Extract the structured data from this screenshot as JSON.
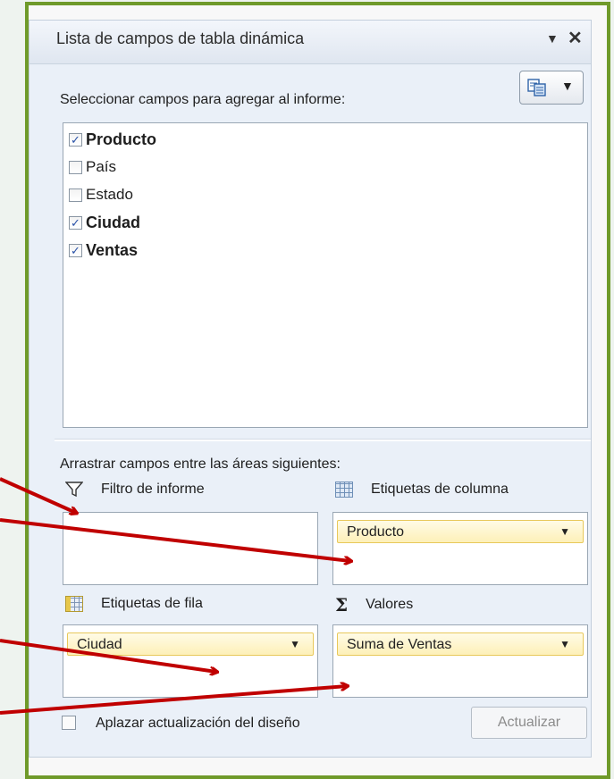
{
  "panel": {
    "title": "Lista de campos de tabla dinámica",
    "title_dropdown_icon": "triangle-down",
    "close_icon": "close-x"
  },
  "view_button": {
    "icon": "field-list-layout-icon"
  },
  "choose_label": "Seleccionar campos para agregar al informe:",
  "fields": [
    {
      "label": "Producto",
      "checked": true
    },
    {
      "label": "País",
      "checked": false
    },
    {
      "label": "Estado",
      "checked": false
    },
    {
      "label": "Ciudad",
      "checked": true
    },
    {
      "label": "Ventas",
      "checked": true
    }
  ],
  "drag_label": "Arrastrar campos entre las áreas siguientes:",
  "areas": {
    "report_filter": {
      "title": "Filtro de informe",
      "icon": "filter-icon",
      "items": []
    },
    "column_labels": {
      "title": "Etiquetas de columna",
      "icon": "column-grid-icon",
      "items": [
        "Producto"
      ]
    },
    "row_labels": {
      "title": "Etiquetas de fila",
      "icon": "row-grid-icon",
      "items": [
        "Ciudad"
      ]
    },
    "values": {
      "title": "Valores",
      "icon": "sigma-icon",
      "symbol": "Σ",
      "items": [
        "Suma de Ventas"
      ]
    }
  },
  "defer_update": {
    "label": "Aplazar actualización del diseño",
    "checked": false
  },
  "update_button": {
    "label": "Actualizar",
    "enabled": false
  },
  "colors": {
    "frame_border": "#6f9a2a",
    "arrow": "#c00000",
    "pill_border": "#e8c85a",
    "pill_fill": "#fdf0b8",
    "check": "#2a52a8"
  }
}
